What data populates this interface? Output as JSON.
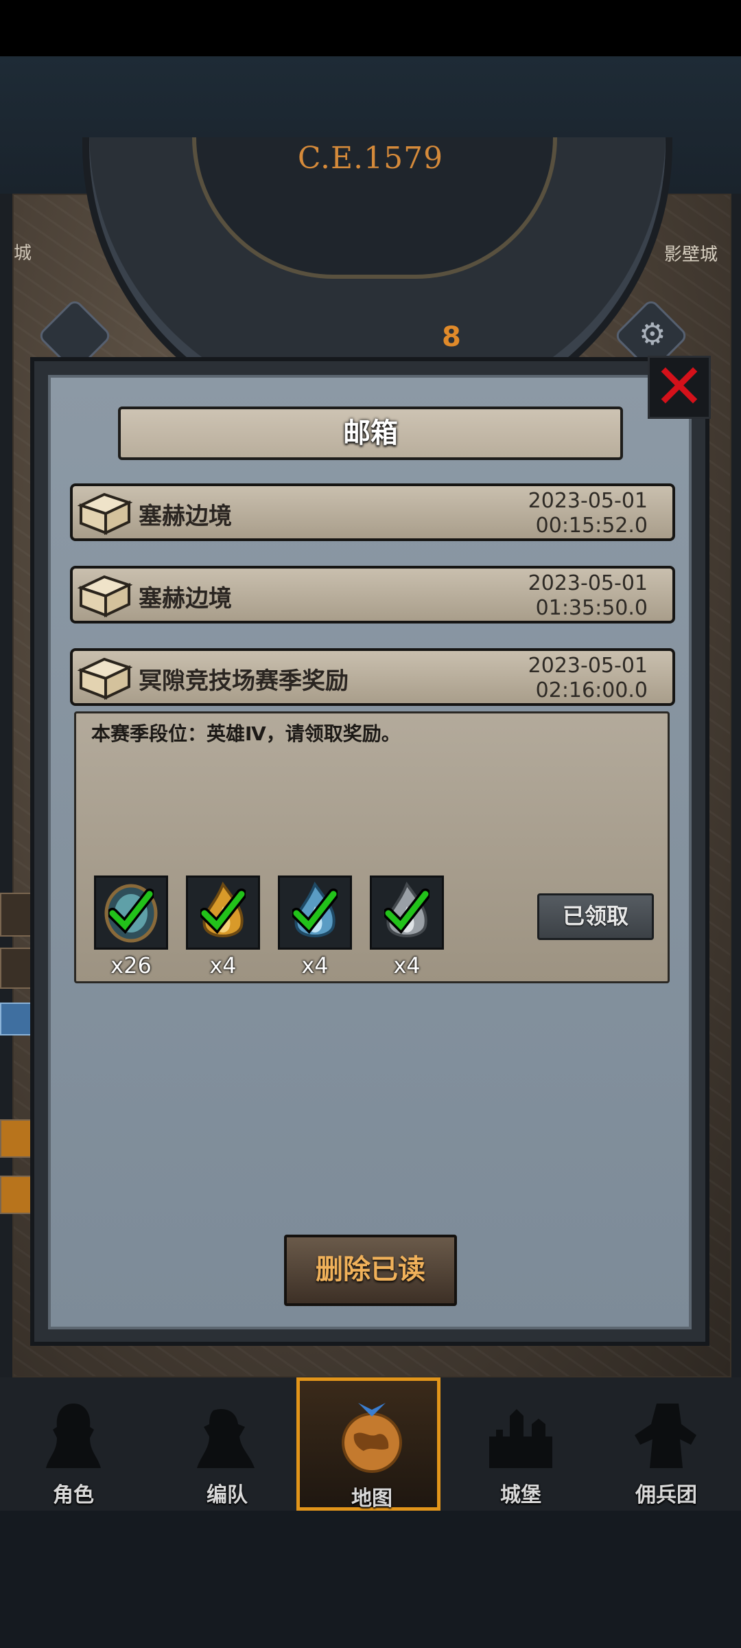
{
  "game": {
    "era_label": "C.E.1579",
    "dial_hour": "8",
    "side_left_text": "城",
    "side_right_text": "影壁城"
  },
  "mailbox": {
    "title": "邮箱",
    "close_icon": "close-x-icon",
    "mails": [
      {
        "title": "塞赫边境",
        "date": "2023-05-01",
        "time": "00:15:52.0",
        "icon": "chest-icon"
      },
      {
        "title": "塞赫边境",
        "date": "2023-05-01",
        "time": "01:35:50.0",
        "icon": "chest-icon"
      },
      {
        "title": "冥隙竞技场赛季奖励",
        "date": "2023-05-01",
        "time": "02:16:00.0",
        "icon": "chest-icon"
      }
    ],
    "open_mail": {
      "body": "本赛季段位：英雄Ⅳ，请领取奖励。",
      "rewards": [
        {
          "icon": "gem-icon",
          "count": "x26",
          "claimed": true
        },
        {
          "icon": "gold-flame-icon",
          "count": "x4",
          "claimed": true
        },
        {
          "icon": "blue-flame-icon",
          "count": "x4",
          "claimed": true
        },
        {
          "icon": "grey-flame-icon",
          "count": "x4",
          "claimed": true
        }
      ],
      "claimed_label": "已领取"
    },
    "delete_read_label": "删除已读"
  },
  "nav": {
    "items": [
      {
        "label": "角色",
        "icon": "knight-icon",
        "active": false
      },
      {
        "label": "编队",
        "icon": "squad-icon",
        "active": false
      },
      {
        "label": "地图",
        "icon": "globe-icon",
        "active": true
      },
      {
        "label": "城堡",
        "icon": "castle-icon",
        "active": false
      },
      {
        "label": "佣兵团",
        "icon": "mercenary-icon",
        "active": false
      }
    ]
  },
  "colors": {
    "accent_orange": "#e2951a",
    "close_red": "#d4111a",
    "check_green": "#22c21a"
  }
}
